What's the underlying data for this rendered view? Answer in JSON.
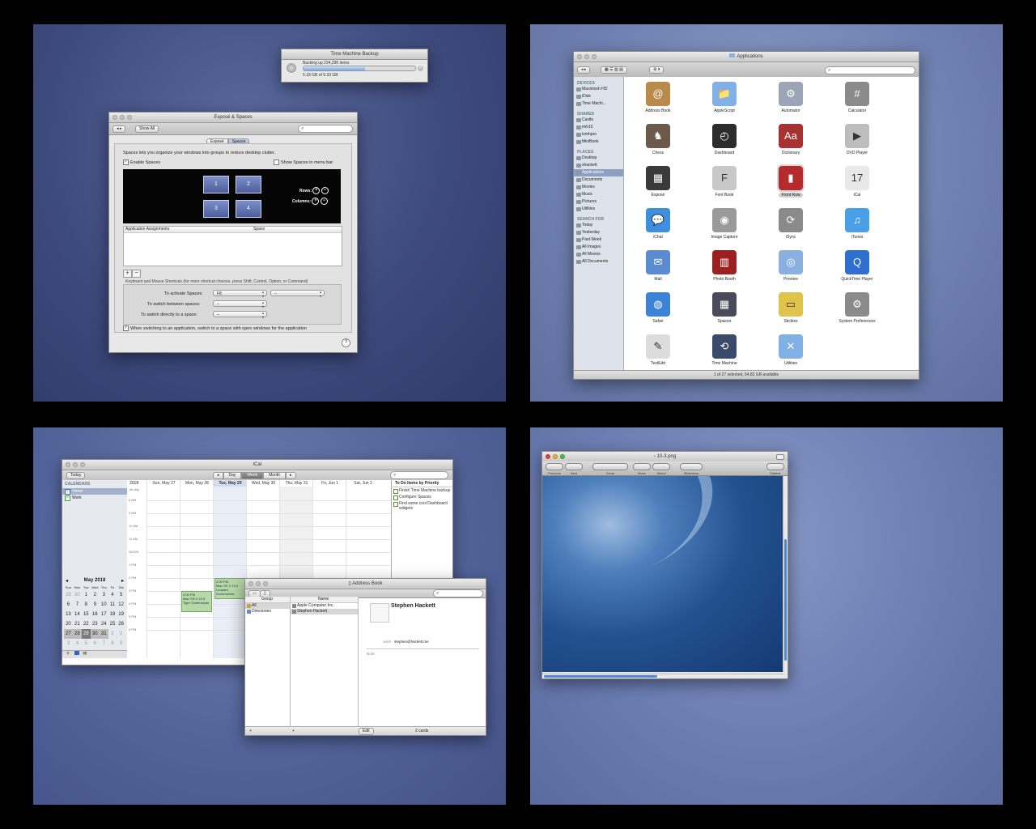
{
  "tm_backup": {
    "title": "Time Machine Backup",
    "status": "Backing up 234,296 items",
    "size": "5.18 GB of 9.33 GB",
    "progress": 0.55
  },
  "expose": {
    "title": "Exposé & Spaces",
    "show_all": "Show All",
    "tabs": [
      "Exposé",
      "Spaces"
    ],
    "description": "Spaces lets you organize your windows into groups to reduce desktop clutter.",
    "enable_spaces": "Enable Spaces",
    "show_menu_bar": "Show Spaces in menu bar",
    "spaces": [
      "1",
      "2",
      "3",
      "4"
    ],
    "rows_label": "Rows:",
    "columns_label": "Columns:",
    "col_app": "Application Assignments",
    "col_space": "Space",
    "shortcuts_note": "Keyboard and Mouse Shortcuts (for more shortcut choices, press Shift, Control, Option, or Command)",
    "activate_label": "To activate Spaces:",
    "activate_value": "F8",
    "activate_mouse": "–",
    "switch_between_label": "To switch between spaces:",
    "switch_between_value": "–",
    "switch_directly_label": "To switch directly to a space:",
    "switch_directly_value": "–",
    "switch_app_label": "When switching to an application, switch to a space with open windows for the application",
    "help": "?"
  },
  "finder": {
    "title": "Applications",
    "sidebar": [
      {
        "header": "DEVICES",
        "items": [
          "Macintosh HD",
          "iDisk",
          "Time Machi..."
        ]
      },
      {
        "header": "SHARED",
        "items": [
          "Castle",
          "imh15",
          "lomhpro",
          "MiniBook"
        ]
      },
      {
        "header": "PLACES",
        "items": [
          "Desktop",
          "shackett",
          "Applications",
          "Documents",
          "Movies",
          "Music",
          "Pictures",
          "Utilities"
        ]
      },
      {
        "header": "SEARCH FOR",
        "items": [
          "Today",
          "Yesterday",
          "Past Week",
          "All Images",
          "All Movies",
          "All Documents"
        ]
      }
    ],
    "apps": [
      "Address Book",
      "AppleScript",
      "Automator",
      "Calculator",
      "Chess",
      "Dashboard",
      "Dictionary",
      "DVD Player",
      "Exposé",
      "Font Book",
      "Front Row",
      "iCal",
      "iChat",
      "Image Capture",
      "iSync",
      "iTunes",
      "Mail",
      "Photo Booth",
      "Preview",
      "QuickTime Player",
      "Safari",
      "Spaces",
      "Stickies",
      "System Preferences",
      "TextEdit",
      "Time Machine",
      "Utilities"
    ],
    "status": "1 of 27 selected, 64.83 GB available"
  },
  "ical": {
    "title": "iCal",
    "today_btn": "Today",
    "views": [
      "Day",
      "Week",
      "Month"
    ],
    "calendars_header": "CALENDARS",
    "calendars": [
      "Home",
      "Work"
    ],
    "year": "2018",
    "days": [
      "Sun, May 27",
      "Mon, May 28",
      "Tue, May 29",
      "Wed, May 30",
      "Thu, May 31",
      "Fri, Jun 1",
      "Sat, Jun 2"
    ],
    "all_day": "all-day",
    "hours": [
      "8 AM",
      "9 AM",
      "10 AM",
      "11 AM",
      "NOON",
      "1 PM",
      "2 PM",
      "3 PM",
      "4 PM",
      "5 PM",
      "6 PM"
    ],
    "events": [
      {
        "time": "2:00 PM",
        "title": "Mac OS X 10.5 Tiger Screenshots"
      },
      {
        "time": "2:00 PM",
        "title": "Mac OS X 10.5 Leopard Screenshots"
      }
    ],
    "todo_header": "To Do Items by Priority",
    "todos": [
      "Finish Time Machine backup",
      "Configure Spaces",
      "Find some cool Dashboard widgets"
    ],
    "mini_month": "May 2018",
    "mini_days": [
      "Sun",
      "Mon",
      "Tue",
      "Wed",
      "Thu",
      "Fri",
      "Sat"
    ],
    "mini_weeks": [
      [
        "29",
        "30",
        "1",
        "2",
        "3",
        "4",
        "5"
      ],
      [
        "6",
        "7",
        "8",
        "9",
        "10",
        "11",
        "12"
      ],
      [
        "13",
        "14",
        "15",
        "16",
        "17",
        "18",
        "19"
      ],
      [
        "20",
        "21",
        "22",
        "23",
        "24",
        "25",
        "26"
      ],
      [
        "27",
        "28",
        "29",
        "30",
        "31",
        "1",
        "2"
      ],
      [
        "3",
        "4",
        "5",
        "6",
        "7",
        "8",
        "9"
      ]
    ]
  },
  "addressbook": {
    "title": "Address Book",
    "group_header": "Group",
    "name_header": "Name",
    "groups": [
      "All",
      "Directories"
    ],
    "names": [
      "Apple Computer Inc.",
      "Stephen Hackett"
    ],
    "contact_name": "Stephen Hackett",
    "email_label": "work",
    "email": "stephen@hackett.me",
    "note_label": "Note:",
    "edit": "Edit",
    "count": "2 cards"
  },
  "preview": {
    "title": "10-3.png",
    "tools": [
      "Previous",
      "Next",
      "Zoom",
      "Move",
      "Select",
      "Slideshow",
      "Sidebar"
    ]
  }
}
